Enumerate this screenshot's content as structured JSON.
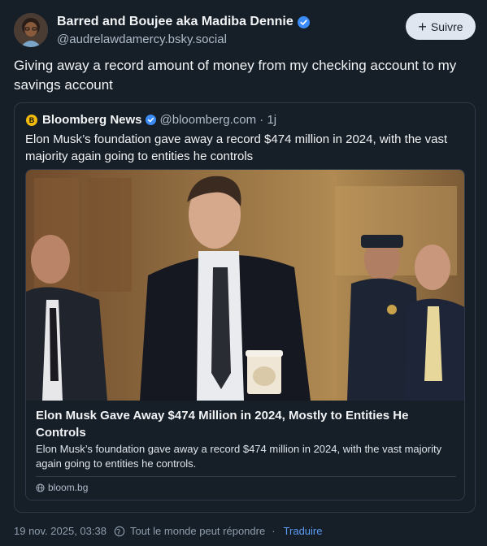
{
  "author": {
    "name": "Barred and Boujee aka Madiba Dennie",
    "handle": "@audrelawdamercy.bsky.social",
    "verified_icon": "verified-check-icon",
    "avatar_icon": "user-avatar"
  },
  "follow_button": {
    "label": "Suivre",
    "icon": "plus-icon"
  },
  "post": {
    "text": "Giving away a record amount of money from my checking account to my savings account"
  },
  "quote": {
    "avatar_letter": "B",
    "name": "Bloomberg News",
    "handle": "@bloomberg.com · 1j",
    "text": "Elon Musk’s foundation gave away a record $474 million in 2024, with the vast majority again going to entities he controls",
    "link_card": {
      "title": "Elon Musk Gave Away $474 Million in 2024, Mostly to Entities He Controls",
      "description": "Elon Musk’s foundation gave away a record $474 million in 2024, with the vast majority again going to entities he controls.",
      "domain": "bloom.bg",
      "image_icon": "news-photo"
    }
  },
  "footer": {
    "timestamp": "19 nov. 2025, 03:38",
    "reply_setting": "Tout le monde peut répondre",
    "separator": "·",
    "translate": "Traduire"
  },
  "colors": {
    "background": "#161e27",
    "accent": "#5b9cf6",
    "verified": "#3b8cf7",
    "border": "#2e3a47",
    "follow_bg": "#dfe6ef"
  }
}
